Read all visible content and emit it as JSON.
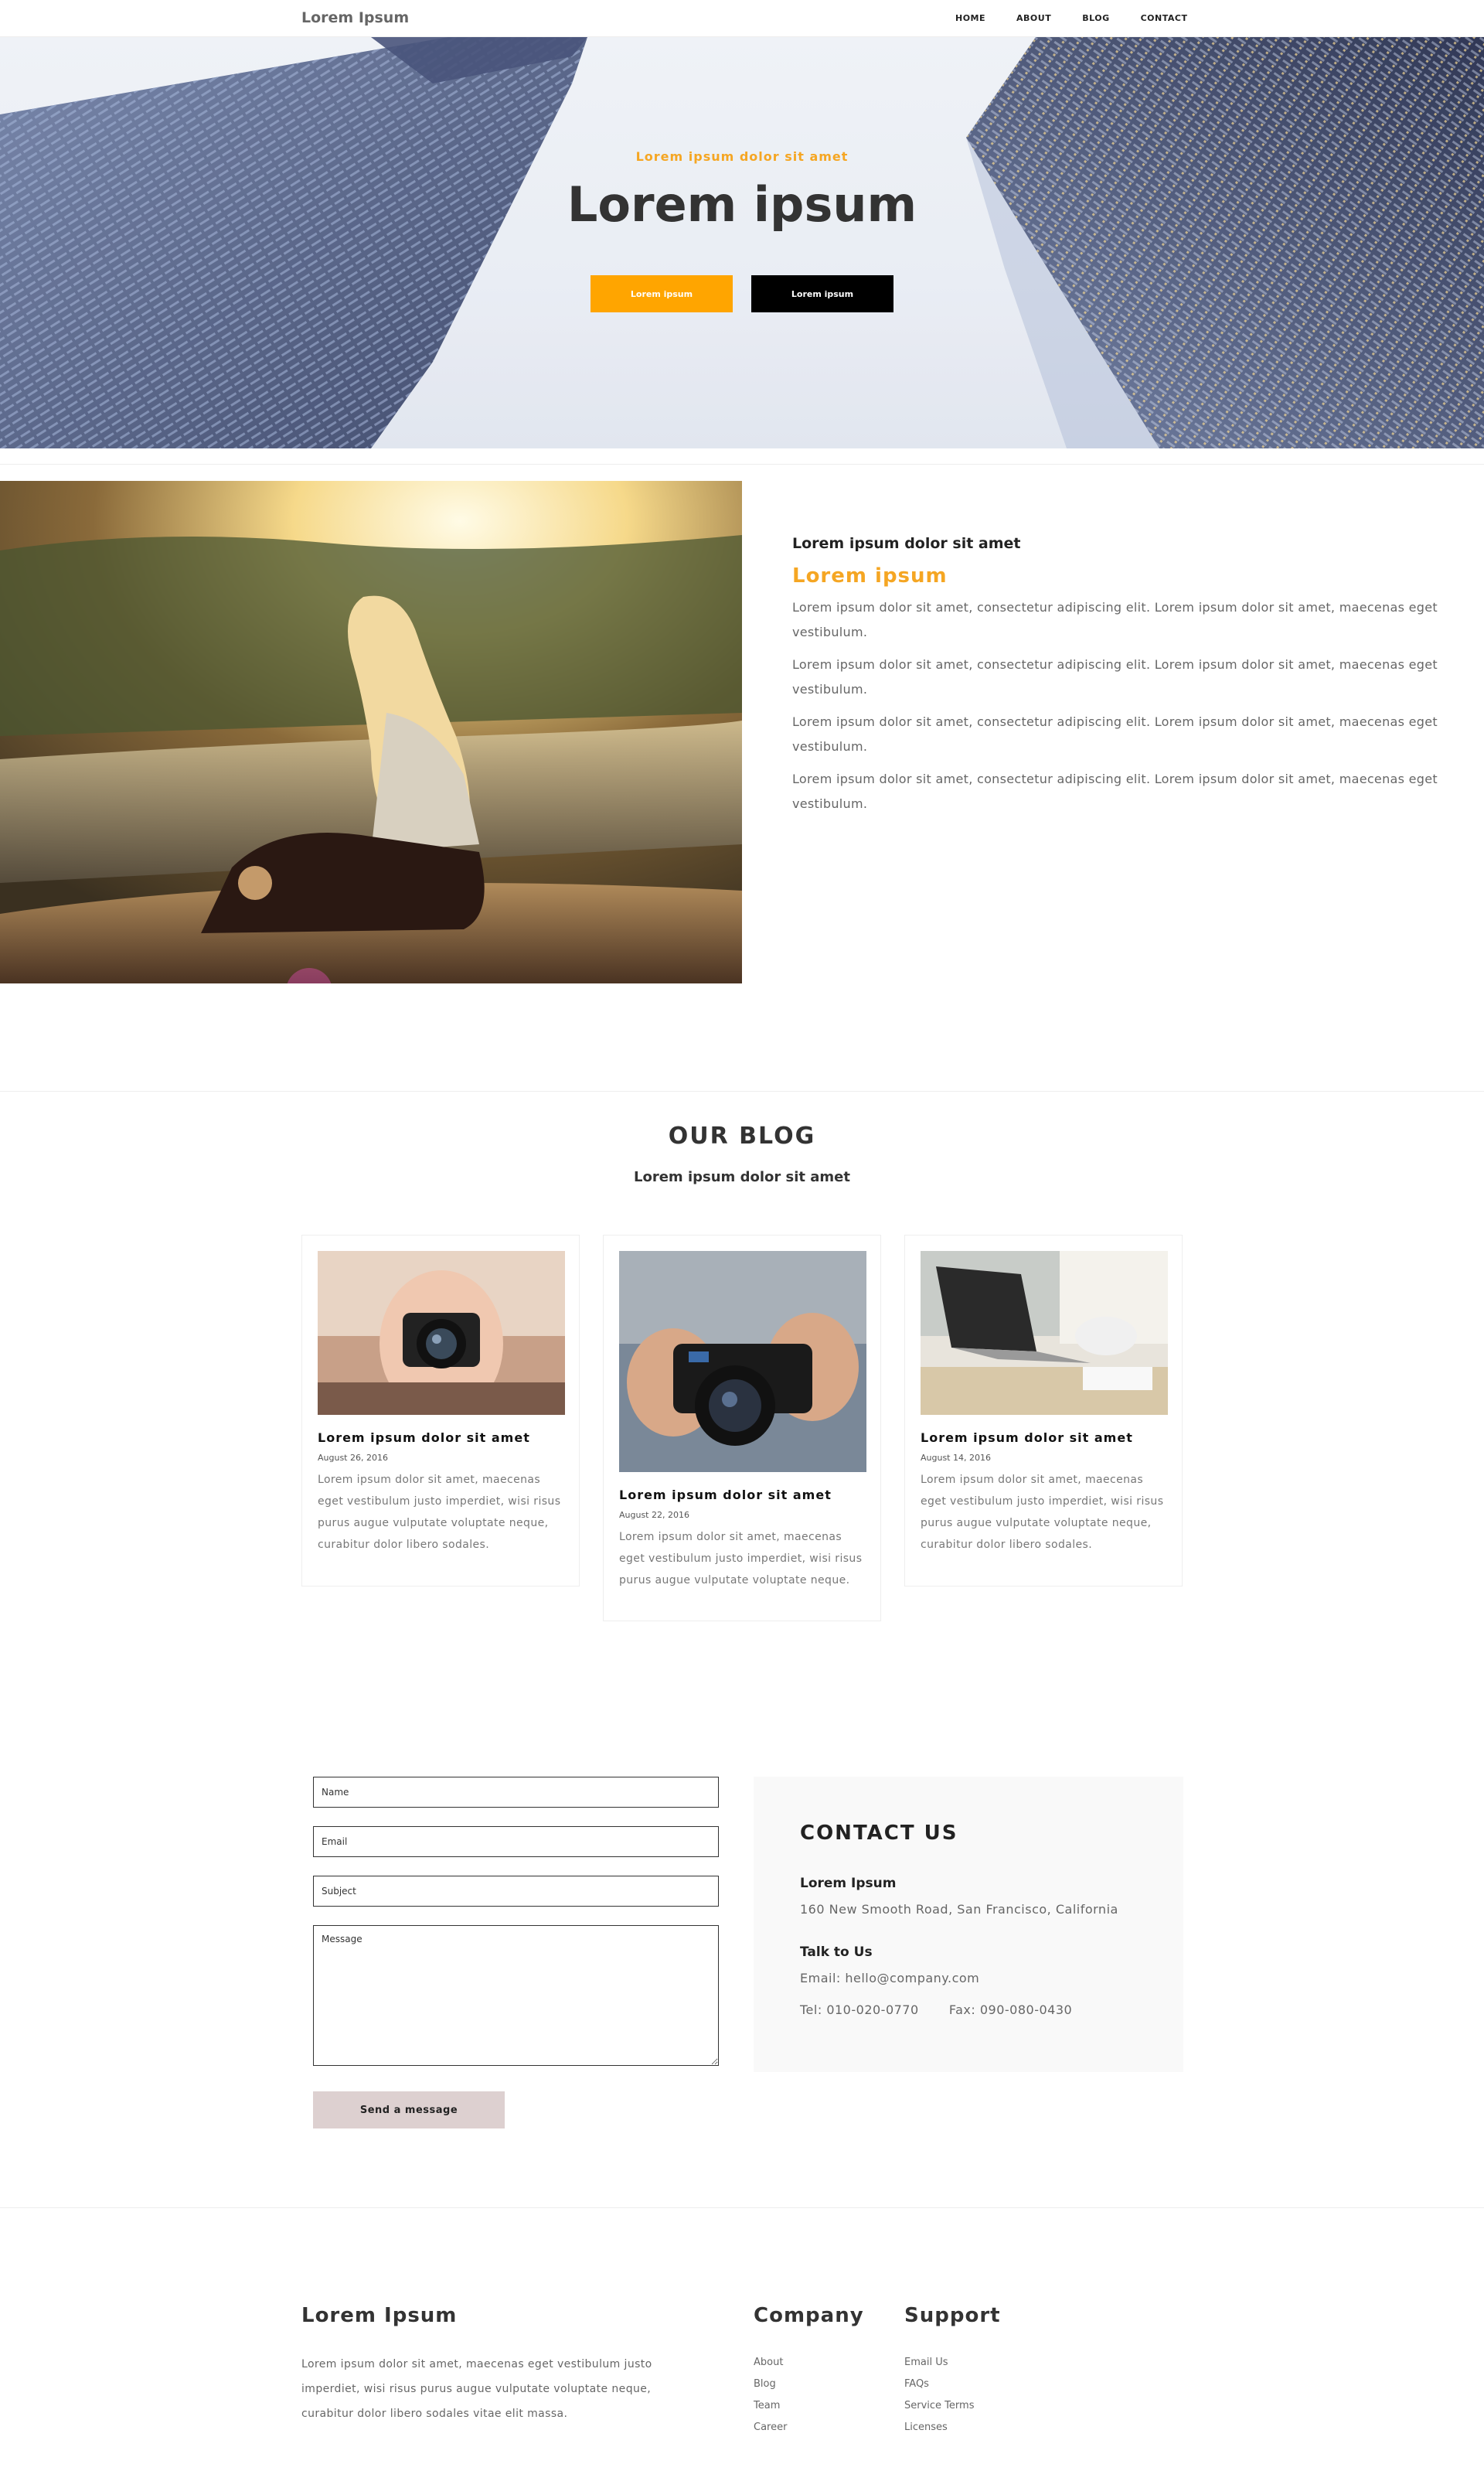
{
  "nav": {
    "brand": "Lorem Ipsum",
    "items": [
      {
        "label": "HOME"
      },
      {
        "label": "ABOUT"
      },
      {
        "label": "BLOG"
      },
      {
        "label": "CONTACT"
      }
    ]
  },
  "hero": {
    "subtitle": "Lorem ipsum dolor sit amet",
    "title": "Lorem ipsum",
    "buttons": [
      {
        "label": "Lorem ipsum",
        "color": "#ffa500"
      },
      {
        "label": "Lorem ipsum",
        "color": "#000000"
      }
    ]
  },
  "about": {
    "kicker": "Lorem ipsum dolor sit amet",
    "title": "Lorem ipsum",
    "paragraphs": [
      "Lorem ipsum dolor sit amet, consectetur adipiscing elit. Lorem ipsum dolor sit amet, maecenas eget vestibulum.",
      "Lorem ipsum dolor sit amet, consectetur adipiscing elit. Lorem ipsum dolor sit amet, maecenas eget vestibulum.",
      "Lorem ipsum dolor sit amet, consectetur adipiscing elit. Lorem ipsum dolor sit amet, maecenas eget vestibulum.",
      "Lorem ipsum dolor sit amet, consectetur adipiscing elit. Lorem ipsum dolor sit amet, maecenas eget vestibulum."
    ]
  },
  "blog": {
    "heading": "OUR BLOG",
    "subheading": "Lorem ipsum dolor sit amet",
    "cards": [
      {
        "title": "Lorem ipsum dolor sit amet",
        "date": "August 26, 2016",
        "text": "Lorem ipsum dolor sit amet, maecenas eget vestibulum justo imperdiet, wisi risus purus augue vulputate voluptate neque, curabitur dolor libero sodales."
      },
      {
        "title": "Lorem ipsum dolor sit amet",
        "date": "August 22, 2016",
        "text": "Lorem ipsum dolor sit amet, maecenas eget vestibulum justo imperdiet, wisi risus purus augue vulputate voluptate neque."
      },
      {
        "title": "Lorem ipsum dolor sit amet",
        "date": "August 14, 2016",
        "text": "Lorem ipsum dolor sit amet, maecenas eget vestibulum justo imperdiet, wisi risus purus augue vulputate voluptate neque, curabitur dolor libero sodales."
      }
    ]
  },
  "contact_form": {
    "name_placeholder": "Name",
    "email_placeholder": "Email",
    "subject_placeholder": "Subject",
    "message_placeholder": "Message",
    "send_label": "Send a message"
  },
  "contact_info": {
    "heading": "CONTACT US",
    "company_label": "Lorem Ipsum",
    "address": "160 New Smooth Road, San Francisco, California",
    "talk_label": "Talk to Us",
    "email": "Email: hello@company.com",
    "tel": "Tel: 010-020-0770",
    "fax": "Fax: 090-080-0430"
  },
  "footer": {
    "brand": "Lorem Ipsum",
    "text": "Lorem ipsum dolor sit amet, maecenas eget vestibulum justo imperdiet, wisi risus purus augue vulputate voluptate neque, curabitur dolor libero sodales vitae elit massa.",
    "company": {
      "heading": "Company",
      "links": [
        "About",
        "Blog",
        "Team",
        "Career"
      ]
    },
    "support": {
      "heading": "Support",
      "links": [
        "Email Us",
        "FAQs",
        "Service Terms",
        "Licenses"
      ]
    }
  }
}
